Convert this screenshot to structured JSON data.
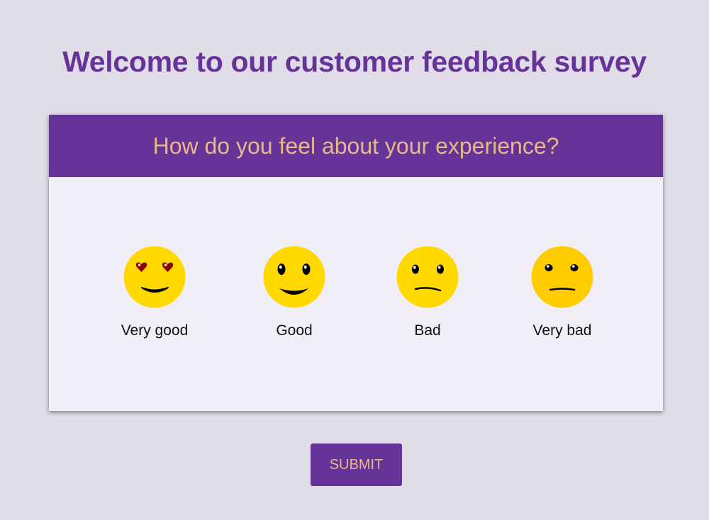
{
  "page": {
    "title": "Welcome to our customer feedback survey"
  },
  "card": {
    "question": "How do you feel about your experience?"
  },
  "options": [
    {
      "label": "Very good",
      "icon": "heart-eyes-emoji-icon"
    },
    {
      "label": "Good",
      "icon": "smiling-emoji-icon"
    },
    {
      "label": "Bad",
      "icon": "frowning-emoji-icon"
    },
    {
      "label": "Very bad",
      "icon": "unamused-emoji-icon"
    }
  ],
  "submit": {
    "label": "SUBMIT"
  },
  "colors": {
    "brand": "#663399",
    "accent_text": "#e5b98c",
    "background": "#e0dde8",
    "card_body": "#f1eef8",
    "emoji_face": "#ffd700",
    "heart": "#8b0000"
  }
}
